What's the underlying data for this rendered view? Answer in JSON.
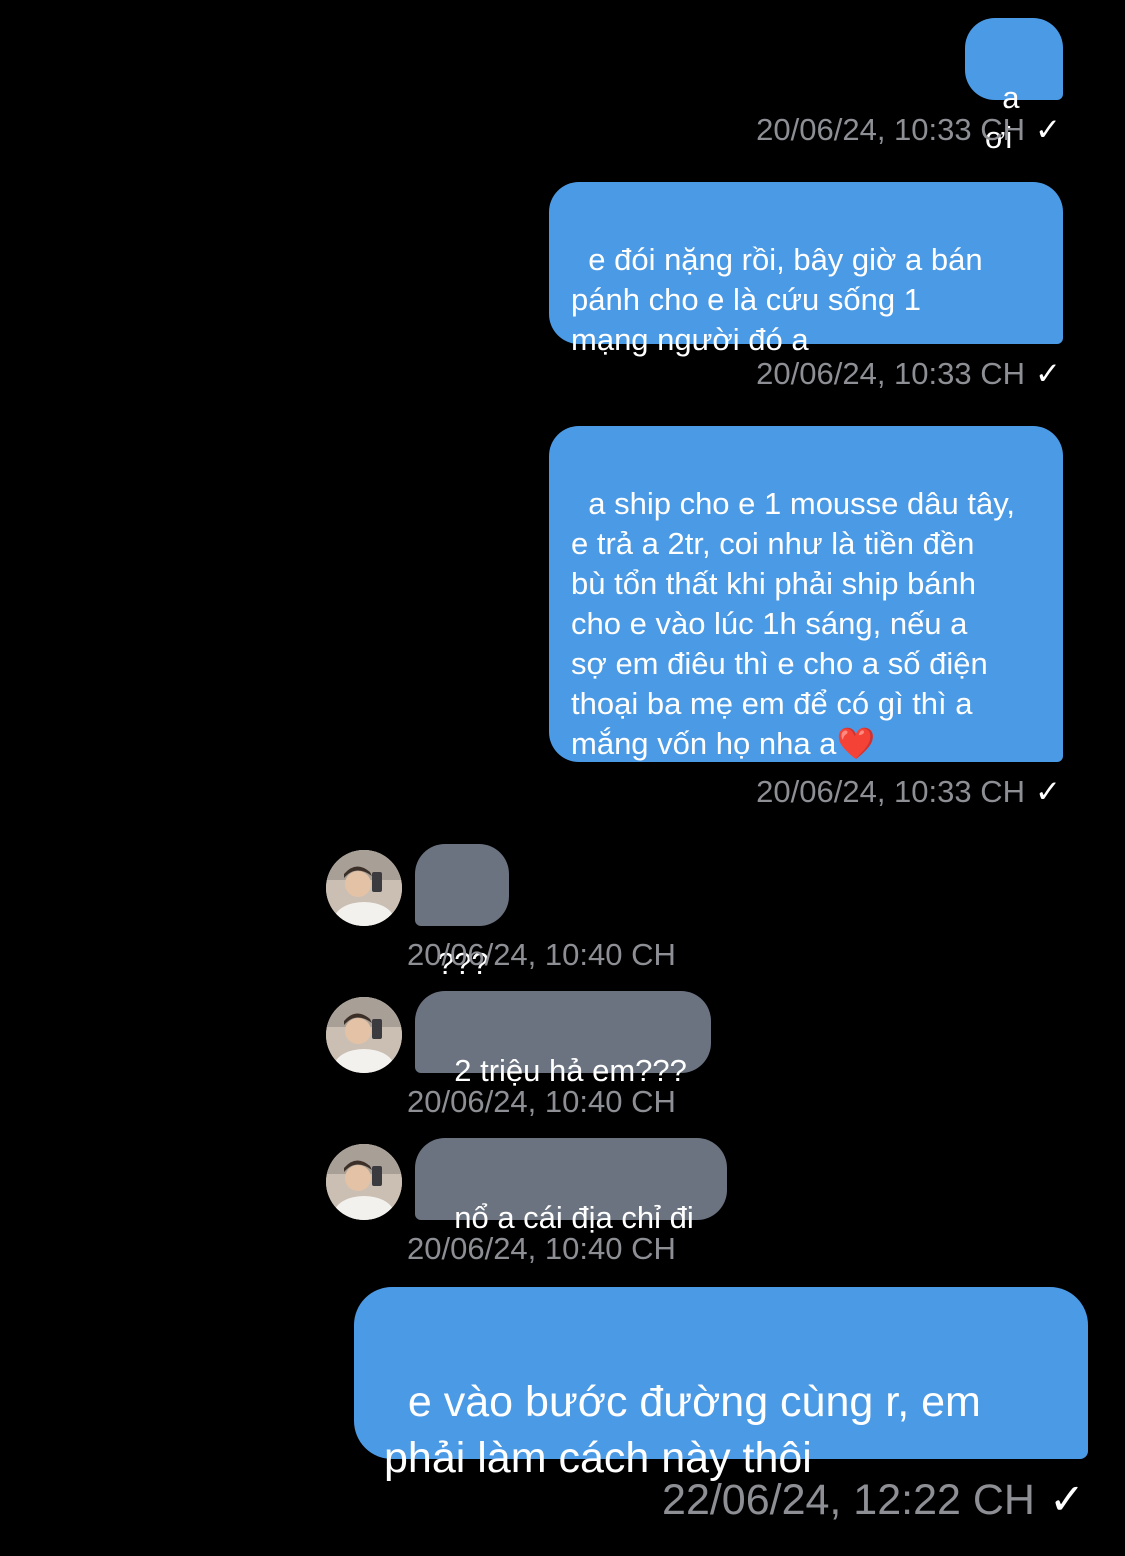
{
  "messages": [
    {
      "side": "out",
      "text": "a ơi",
      "time": "20/06/24, 10:33 CH",
      "status_icon": "✓"
    },
    {
      "side": "out",
      "text": "e đói nặng rồi, bây giờ a bán\npánh cho e là cứu sống 1\nmạng người đó a",
      "time": "20/06/24, 10:33 CH",
      "status_icon": "✓"
    },
    {
      "side": "out",
      "text": "a ship cho e 1 mousse dâu tây,\ne trả a 2tr, coi như là tiền đền\nbù tổn thất khi phải ship bánh\ncho e vào lúc 1h sáng, nếu a\nsợ em điêu thì e cho a số điện\nthoại ba mẹ em để có gì thì a\nmắng vốn họ nha a",
      "emoji": "❤️",
      "time": "20/06/24, 10:33 CH",
      "status_icon": "✓"
    },
    {
      "side": "in",
      "text": "???",
      "time": "20/06/24, 10:40 CH"
    },
    {
      "side": "in",
      "text": "2 triệu hả em???",
      "time": "20/06/24, 10:40 CH"
    },
    {
      "side": "in",
      "text": "nổ a cái địa chỉ đi",
      "time": "20/06/24, 10:40 CH"
    },
    {
      "side": "out",
      "text": "e vào bước đường cùng r, em\nphải làm cách này thôi",
      "time": "22/06/24, 12:22 CH",
      "status_icon": "✓"
    }
  ],
  "colors": {
    "background": "#000000",
    "outgoing_bubble": "#4b9ae6",
    "incoming_bubble": "#6b7381",
    "timestamp": "#8d8f95"
  },
  "icons": {
    "avatar": "contact-avatar-photo",
    "read_receipt": "checkmark-icon"
  }
}
